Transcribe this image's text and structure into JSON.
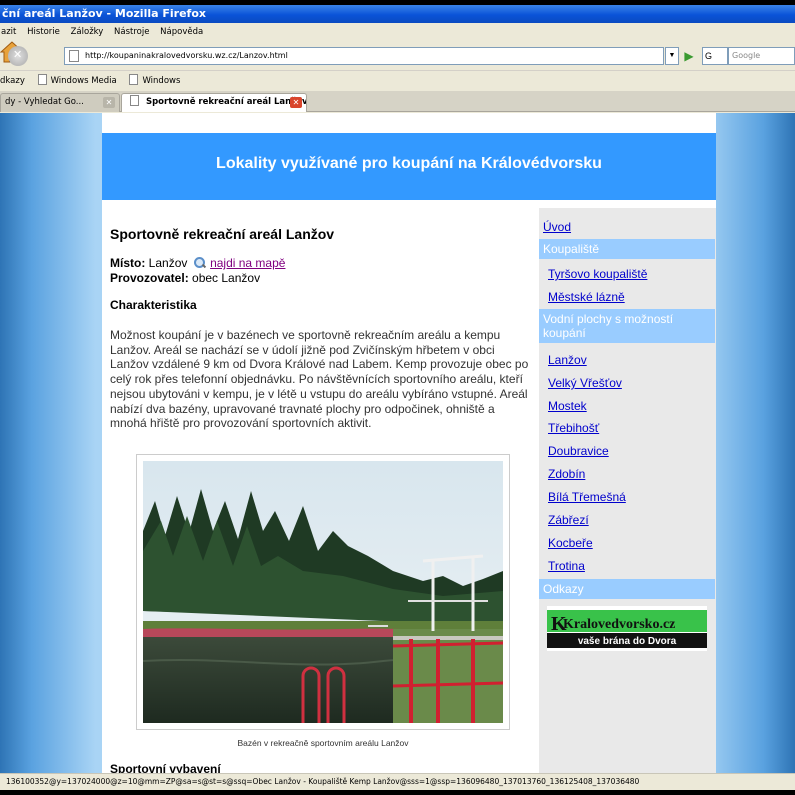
{
  "window": {
    "title": "ční areál Lanžov - Mozilla Firefox"
  },
  "menu": {
    "items": [
      "azit",
      "Historie",
      "Záložky",
      "Nástroje",
      "Nápověda"
    ]
  },
  "navbar": {
    "url": "http://koupaninakralovedvorsku.wz.cz/Lanzov.html",
    "search_placeholder": "Google",
    "search_engine": "G"
  },
  "bookmarks": {
    "items": [
      "dkazy",
      "Windows Media",
      "Windows"
    ]
  },
  "tabs": [
    {
      "label": "dy - Vyhledat Go...",
      "active": false
    },
    {
      "label": "Sportovně rekreační areál Lanžov",
      "active": true
    }
  ],
  "site": {
    "header": "Lokality využívané pro koupání na Královédvorsku"
  },
  "content": {
    "heading": "Sportovně rekreační areál Lanžov",
    "place_label": "Místo:",
    "place_value": "Lanžov",
    "map_link": "najdi na mapě",
    "operator_label": "Provozovatel:",
    "operator_value": "obec Lanžov",
    "characteristics_heading": "Charakteristika",
    "description": "Možnost koupání je v bazénech ve sportovně rekreačním areálu a kempu Lanžov. Areál se nachází se v údolí jižně pod Zvičínským hřbetem v obci Lanžov vzdálené 9 km od Dvora Králové nad Labem. Kemp provozuje obec po celý rok přes telefonní objednávku. Po návštěvnících sportovního areálu, kteří nejsou ubytováni v kempu, je v létě u vstupu do areálu vybíráno vstupné. Areál nabízí dva bazény, upravované travnaté plochy pro odpočinek, ohniště a mnohá hřiště pro provozování sportovních aktivit.",
    "photo_caption": "Bazén v rekreačně sportovním areálu Lanžov",
    "sport_heading": "Sportovní vybavení"
  },
  "sidebar": {
    "intro": "Úvod",
    "pools_heading": "Koupaliště",
    "pools": [
      "Tyršovo koupaliště",
      "Městské lázně"
    ],
    "waters_heading": "Vodní plochy s možností koupání",
    "waters": [
      "Lanžov",
      "Velký Vřešťov",
      "Mostek",
      "Třebihošť",
      "Doubravice",
      "Zdobín",
      "Bílá Třemešná",
      "Zábřezí",
      "Kocbeře",
      "Trotina"
    ],
    "links_heading": "Odkazy",
    "logo_title": "Kralovedvorsko.cz",
    "logo_tagline": "vaše brána do Dvora"
  },
  "status": {
    "text": "136100352@y=137024000@z=10@mm=ZP@sa=s@st=s@ssq=Obec Lanžov - Koupaliště Kemp Lanžov@sss=1@ssp=136096480_137013760_136125408_137036480"
  },
  "colors": {
    "header_blue": "#3399ff",
    "sidebar_heading": "#99ccff",
    "link": "#0000cc",
    "visited": "#800080"
  }
}
